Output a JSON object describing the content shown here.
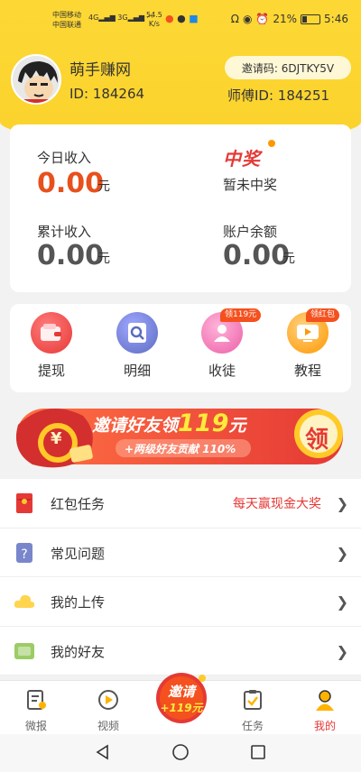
{
  "status_bar": {
    "carrier1": "中国移动",
    "carrier2": "中国联通",
    "net1": "4G",
    "net2": "3G",
    "speed": "54.5",
    "speed_unit": "K/s",
    "battery": "21%",
    "time": "5:46"
  },
  "profile": {
    "name": "萌手赚网",
    "id_label": "ID: 184264",
    "invite_code": "邀请码: 6DJTKY5V",
    "master_id": "师傅ID: 184251"
  },
  "income": {
    "today_label": "今日收入",
    "today_value": "0.00",
    "today_unit": "元",
    "prize_logo": "中奖",
    "prize_status": "暂未中奖",
    "total_label": "累计收入",
    "total_value": "0.00",
    "total_unit": "元",
    "balance_label": "账户余额",
    "balance_value": "0.00",
    "balance_unit": "元",
    "accent": "#e8501c"
  },
  "quick_actions": [
    {
      "label": "提现",
      "icon": "wallet-icon",
      "badge": ""
    },
    {
      "label": "明细",
      "icon": "search-document-icon",
      "badge": ""
    },
    {
      "label": "收徒",
      "icon": "apprentice-icon",
      "badge": "领119元"
    },
    {
      "label": "教程",
      "icon": "tutorial-icon",
      "badge": "领红包"
    }
  ],
  "banner": {
    "title": "邀请好友领",
    "amount": "119",
    "unit": "元",
    "subtitle": "+两级好友贡献 110%",
    "claim": "领",
    "bag_symbol": "¥"
  },
  "menu": [
    {
      "label": "红包任务",
      "icon": "red-envelope-icon",
      "extra": "每天赢现金大奖"
    },
    {
      "label": "常见问题",
      "icon": "question-icon",
      "extra": ""
    },
    {
      "label": "我的上传",
      "icon": "upload-cloud-icon",
      "extra": ""
    },
    {
      "label": "我的好友",
      "icon": "friends-icon",
      "extra": ""
    }
  ],
  "tabbar": {
    "items": [
      {
        "label": "微报",
        "icon": "news-icon"
      },
      {
        "label": "视频",
        "icon": "video-play-icon"
      },
      {
        "label": "任务",
        "icon": "task-icon"
      },
      {
        "label": "我的",
        "icon": "profile-icon"
      }
    ],
    "fab_line1": "邀请",
    "fab_line2": "+119元"
  },
  "colors": {
    "brand_yellow": "#fdd835",
    "accent_red": "#e53935"
  }
}
